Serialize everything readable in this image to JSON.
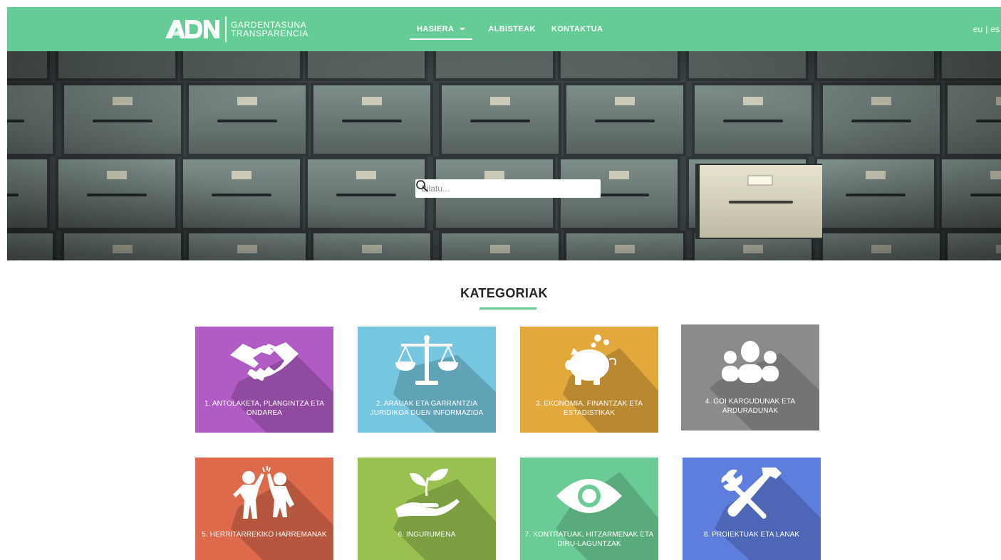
{
  "header": {
    "logo_line1": "GARDENTASUNA",
    "logo_line2": "TRANSPARENCIA",
    "nav": [
      {
        "label": "HASIERA"
      },
      {
        "label": "ALBISTEAK"
      },
      {
        "label": "KONTAKTUA"
      }
    ],
    "lang": {
      "eu": "eu",
      "sep": "|",
      "es": "es"
    }
  },
  "search": {
    "placeholder": "Bilatu..."
  },
  "categories": {
    "title": "KATEGORIAK",
    "items": [
      {
        "label": "1. ANTOLAKETA, PLANGINTZA ETA ONDAREA",
        "color": "#b05cc4",
        "icon": "handshake-icon"
      },
      {
        "label": "2. ARAUAK ETA GARRANTZIA JURIDIKOA DUEN INFORMAZIOA",
        "color": "#76c6df",
        "icon": "scales-icon"
      },
      {
        "label": "3. EKONOMIA, FINANTZAK ETA ESTADISTIKAK",
        "color": "#e2a83c",
        "icon": "piggy-bank-icon"
      },
      {
        "label": "4. GOI KARGUDUNAK ETA ARDURADUNAK",
        "color": "#8b8b8b",
        "icon": "people-icon"
      },
      {
        "label": "5. HERRITARREKIKO HARREMANAK",
        "color": "#de6a4c",
        "icon": "high-five-icon"
      },
      {
        "label": "6. INGURUMENA",
        "color": "#98c14f",
        "icon": "plant-hand-icon"
      },
      {
        "label": "7. KONTRATUAK, HITZARMENAK ETA DIRU-LAGUNTZAK",
        "color": "#6acc94",
        "icon": "eye-icon"
      },
      {
        "label": "8. PROIEKTUAK ETA LANAK",
        "color": "#5e7ede",
        "icon": "tools-icon"
      }
    ]
  }
}
